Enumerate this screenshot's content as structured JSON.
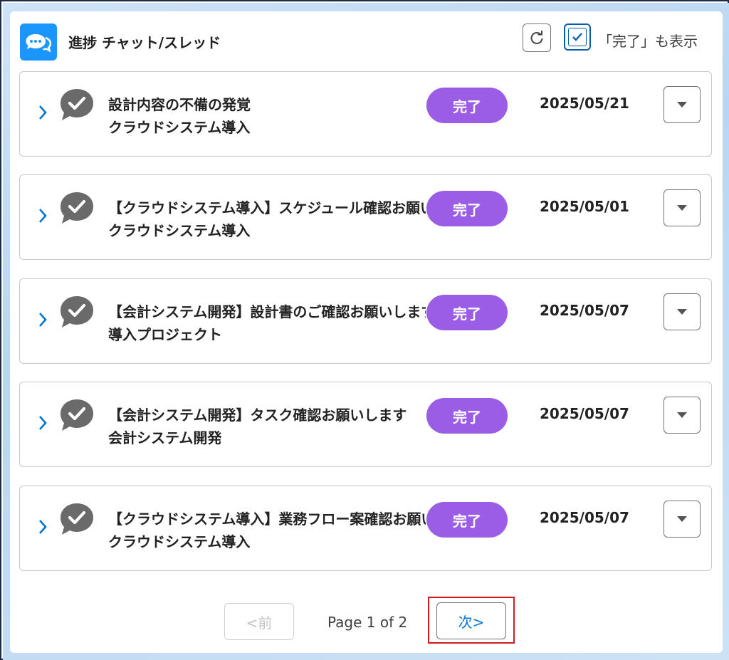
{
  "header": {
    "title": "進捗 チャット/スレッド",
    "show_done_label": "「完了」も表示",
    "show_done_checked": true
  },
  "colors": {
    "accent": "#1b96ff",
    "status_badge": "#9b5de5",
    "link": "#0176d3",
    "highlight": "#d11a1a"
  },
  "rows": [
    {
      "title": "設計内容の不備の発覚",
      "subtitle": "クラウドシステム導入",
      "status": "完了",
      "date": "2025/05/21"
    },
    {
      "title": "【クラウドシステム導入】スケジュール確認お願いします",
      "subtitle": "クラウドシステム導入",
      "status": "完了",
      "date": "2025/05/01"
    },
    {
      "title": "【会計システム開発】設計書のご確認お願いします",
      "subtitle": "導入プロジェクト",
      "status": "完了",
      "date": "2025/05/07"
    },
    {
      "title": "【会計システム開発】タスク確認お願いします",
      "subtitle": "会計システム開発",
      "status": "完了",
      "date": "2025/05/07"
    },
    {
      "title": "【クラウドシステム導入】業務フロー案確認お願いします",
      "subtitle": "クラウドシステム導入",
      "status": "完了",
      "date": "2025/05/07"
    }
  ],
  "pagination": {
    "prev_label": "<前",
    "page_label": "Page 1 of 2",
    "next_label": "次>"
  },
  "icons": {
    "app": "chat-bubbles-icon",
    "refresh": "refresh-icon",
    "row_expand": "chevron-right-icon",
    "row_status": "check-bubble-icon",
    "row_menu": "caret-down-icon"
  }
}
